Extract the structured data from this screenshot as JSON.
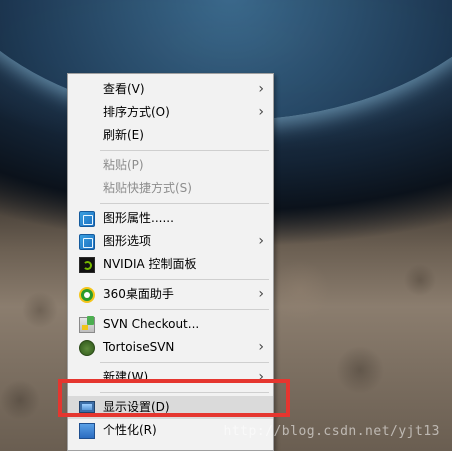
{
  "context_menu": {
    "items": [
      {
        "label": "查看(V)",
        "has_submenu": true,
        "disabled": false
      },
      {
        "label": "排序方式(O)",
        "has_submenu": true,
        "disabled": false
      },
      {
        "label": "刷新(E)",
        "has_submenu": false,
        "disabled": false
      },
      {
        "label": "粘贴(P)",
        "has_submenu": false,
        "disabled": true
      },
      {
        "label": "粘贴快捷方式(S)",
        "has_submenu": false,
        "disabled": true
      },
      {
        "label": "图形属性......",
        "has_submenu": false,
        "disabled": false,
        "icon": "graphics-icon"
      },
      {
        "label": "图形选项",
        "has_submenu": true,
        "disabled": false,
        "icon": "graphics-icon"
      },
      {
        "label": "NVIDIA 控制面板",
        "has_submenu": false,
        "disabled": false,
        "icon": "nvidia-icon"
      },
      {
        "label": "360桌面助手",
        "has_submenu": true,
        "disabled": false,
        "icon": "360-icon"
      },
      {
        "label": "SVN Checkout...",
        "has_submenu": false,
        "disabled": false,
        "icon": "svn-checkout-icon"
      },
      {
        "label": "TortoiseSVN",
        "has_submenu": true,
        "disabled": false,
        "icon": "tortoise-icon"
      },
      {
        "label": "新建(W)",
        "has_submenu": true,
        "disabled": false
      },
      {
        "label": "显示设置(D)",
        "has_submenu": false,
        "disabled": false,
        "icon": "display-icon",
        "highlighted": true
      },
      {
        "label": "个性化(R)",
        "has_submenu": false,
        "disabled": false,
        "icon": "personalize-icon"
      }
    ],
    "submenu_arrow": "›"
  },
  "annotation": {
    "highlight_color": "#e5362f"
  },
  "watermark": {
    "text": "http://blog.csdn.net/yjt13"
  },
  "colors": {
    "menu_background": "#f2f2f2",
    "menu_highlight": "#dadada",
    "disabled_text": "#8d8d8d"
  }
}
